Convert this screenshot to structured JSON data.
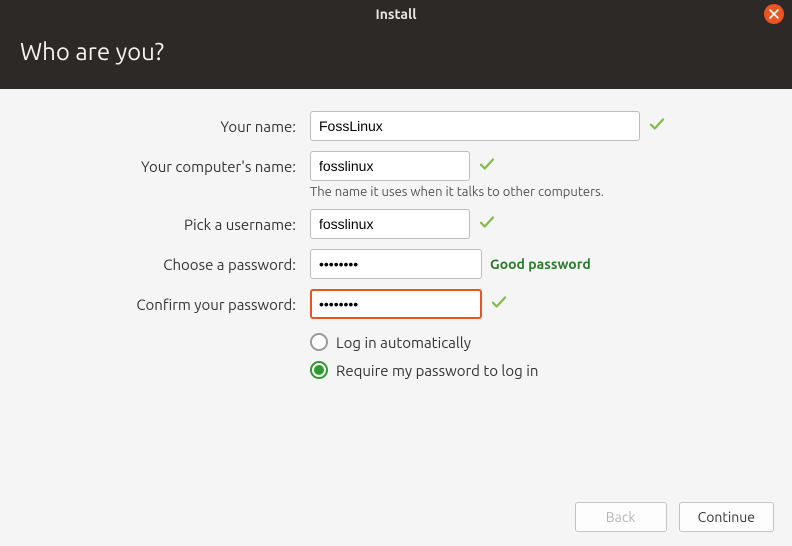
{
  "window": {
    "title": "Install"
  },
  "header": {
    "heading": "Who are you?"
  },
  "form": {
    "name": {
      "label": "Your name:",
      "value": "FossLinux"
    },
    "computer": {
      "label": "Your computer's name:",
      "value": "fosslinux",
      "hint": "The name it uses when it talks to other computers."
    },
    "username": {
      "label": "Pick a username:",
      "value": "fosslinux"
    },
    "password": {
      "label": "Choose a password:",
      "value": "••••••••",
      "strength": "Good password"
    },
    "confirm": {
      "label": "Confirm your password:",
      "value": "••••••••"
    },
    "login_options": {
      "auto": {
        "label": "Log in automatically",
        "selected": false
      },
      "require": {
        "label": "Require my password to log in",
        "selected": true
      }
    }
  },
  "footer": {
    "back": "Back",
    "continue": "Continue"
  }
}
